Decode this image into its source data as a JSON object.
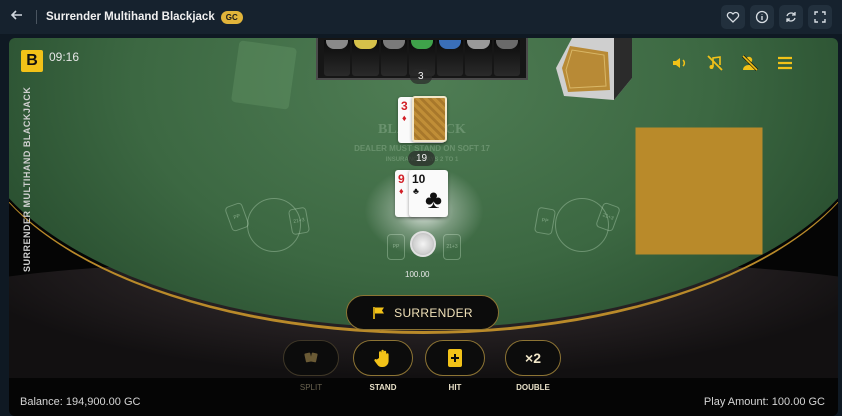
{
  "header": {
    "back_icon": "arrow-left-icon",
    "title": "Surrender Multihand Blackjack",
    "badge": "GC",
    "icons": [
      "heart-icon",
      "info-icon",
      "refresh-icon",
      "fullscreen-icon"
    ]
  },
  "game": {
    "logo": "B",
    "clock": "09:16",
    "side_title": "SURRENDER MULTIHAND BLACKJACK",
    "dealer": {
      "count": "3",
      "card": {
        "rank": "3",
        "suit": "♦",
        "suit_color": "#d21f26"
      }
    },
    "player": {
      "count": "19",
      "cards": [
        {
          "rank": "9",
          "suit": "♦",
          "suit_color": "#d21f26"
        },
        {
          "rank": "10",
          "suit": "♣",
          "suit_color": "#111111"
        }
      ],
      "bet": "100.00"
    },
    "table_print": {
      "line1": "BLACKJACK",
      "line2": "DEALER MUST STAND ON SOFT 17",
      "line3": "INSURANCE PAYS 2 TO 1"
    },
    "spot_labels": {
      "pp": "PP",
      "side": "21+3"
    },
    "controls": [
      "sound-icon",
      "no-music-icon",
      "no-dealer-voice-icon",
      "menu-icon"
    ]
  },
  "actions": {
    "surrender": "SURRENDER",
    "split": "SPLIT",
    "stand": "STAND",
    "hit": "HIT",
    "double": "DOUBLE",
    "double_glyph": "×2"
  },
  "footer": {
    "balance": "Balance: 194,900.00 GC",
    "play_amount": "Play Amount: 100.00 GC"
  },
  "colors": {
    "accent_gold": "#e1b43a",
    "felt_green": "#3c6842",
    "button_border": "#8d7434"
  }
}
